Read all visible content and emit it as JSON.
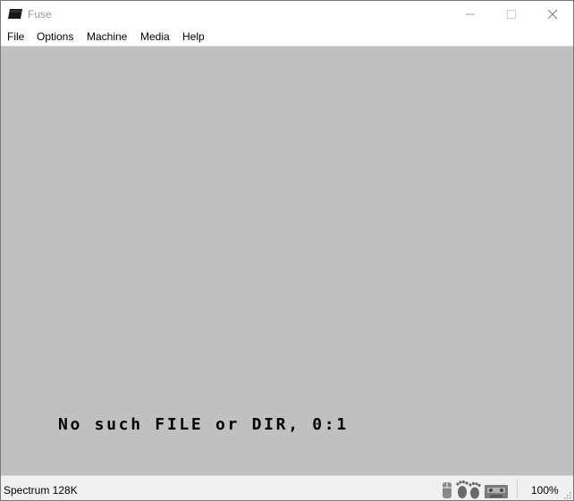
{
  "window": {
    "title": "Fuse",
    "controls": {
      "minimize": "minimize-icon",
      "maximize": "maximize-icon",
      "close": "close-icon"
    }
  },
  "menu": {
    "items": [
      {
        "label": "File"
      },
      {
        "label": "Options"
      },
      {
        "label": "Machine"
      },
      {
        "label": "Media"
      },
      {
        "label": "Help"
      }
    ]
  },
  "screen": {
    "background": "#c0c0c0",
    "message": "No such FILE or DIR, 0:1"
  },
  "status": {
    "machine": "Spectrum 128K",
    "icons": [
      "mouse-icon",
      "disk-activity-icon",
      "tape-icon"
    ],
    "speed": "100%"
  }
}
